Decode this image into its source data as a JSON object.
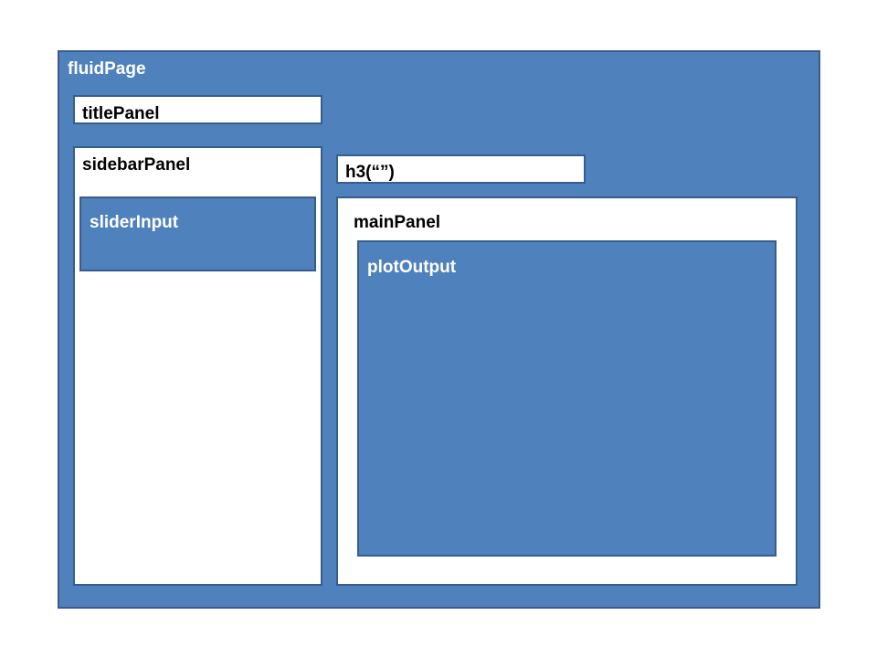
{
  "diagram": {
    "fluid_page": {
      "label": "fluidPage"
    },
    "title_panel": {
      "label": "titlePanel"
    },
    "sidebar_panel": {
      "label": "sidebarPanel"
    },
    "slider_input": {
      "label": "sliderInput"
    },
    "h3": {
      "label": "h3(“”)"
    },
    "main_panel": {
      "label": "mainPanel"
    },
    "plot_output": {
      "label": "plotOutput"
    }
  },
  "colors": {
    "fill_blue": "#4f81bd",
    "border_blue": "#385d8a",
    "fill_white": "#ffffff"
  }
}
